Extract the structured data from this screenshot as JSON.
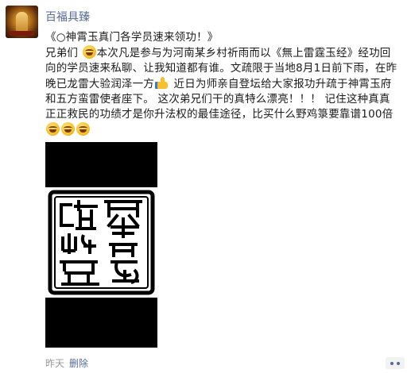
{
  "post": {
    "username": "百福具臻",
    "lines": {
      "l1": "《○神霄玉真门各学员速来领功！》",
      "l2a": "兄弟们",
      "l2b": "本次凡是参与为河南某乡村祈雨而以《無上雷霆玉经》经功回",
      "l3": "向的学员速来私聊、让我知道都有谁。文疏限于当地8月1日前下雨，在昨",
      "l4a": "晚已龙雷大验润泽一方",
      "l4b": "近日为师亲自登坛给大家报功升疏于神霄玉府",
      "l5": "和五方蛮雷使者座下。 这次弟兄们干的真特么漂亮！！！   记住这种真真",
      "l6": "正正救民的功绩才是你升法权的最佳途径，比买什么野鸡箓要靠谱100倍"
    },
    "icons": {
      "emoji": "grinning-face-icon",
      "thumb": "thumbs-up-icon"
    }
  },
  "footer": {
    "time": "昨天",
    "delete_label": "删除"
  },
  "colors": {
    "link": "#576b95",
    "meta": "#999999"
  }
}
